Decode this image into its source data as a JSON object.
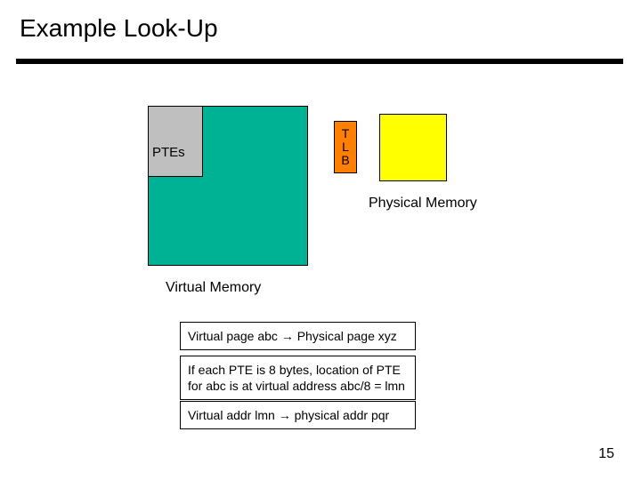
{
  "title": "Example Look-Up",
  "diagram": {
    "pte_label": "PTEs",
    "tlb_letters": [
      "T",
      "L",
      "B"
    ],
    "physical_memory_label": "Physical Memory",
    "virtual_memory_label": "Virtual Memory"
  },
  "explain": {
    "line1_pre": "Virtual page  abc ",
    "line1_post": " Physical page  xyz",
    "line2": "If each PTE is 8 bytes, location of PTE for abc is at virtual address  abc/8 = lmn",
    "line3_pre": "Virtual addr  lmn ",
    "line3_post": " physical addr  pqr"
  },
  "arrow_glyph": "→",
  "page_number": "15"
}
